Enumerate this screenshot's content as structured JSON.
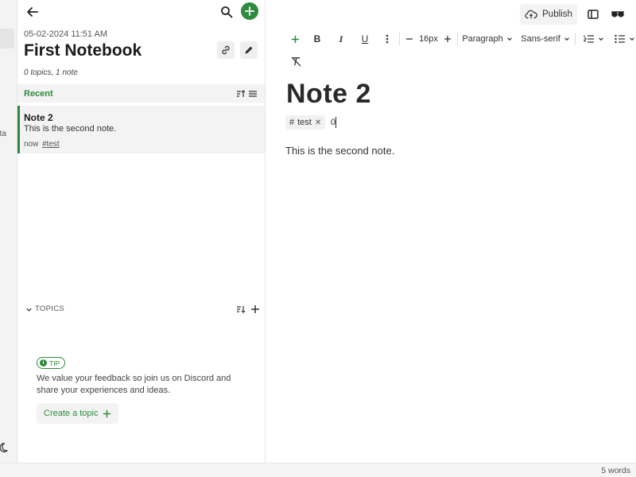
{
  "nav": {
    "beta_text": "eta"
  },
  "notebook": {
    "date": "05-02-2024 11:51 AM",
    "title": "First Notebook",
    "meta": "0 topics, 1 note"
  },
  "recent": {
    "label": "Recent",
    "notes": [
      {
        "title": "Note 2",
        "preview": "This is the second note.",
        "time": "now",
        "tag": "#test"
      }
    ]
  },
  "topics": {
    "label": "TOPICS",
    "tip_label": "TIP",
    "tip_text": "We value your feedback so join us on Discord and share your experiences and ideas.",
    "create_label": "Create a topic"
  },
  "header": {
    "publish_label": "Publish"
  },
  "toolbar": {
    "font_size": "16px",
    "block_type": "Paragraph",
    "font_family": "Sans-serif"
  },
  "editor": {
    "title": "Note 2",
    "tag": "test",
    "tag_input_value": "0",
    "body": "This is the second note."
  },
  "status": {
    "word_count": "5 words"
  },
  "colors": {
    "accent": "#2e8b3e"
  },
  "icons": [
    "arrow-left-icon",
    "search-icon",
    "plus-icon",
    "link-icon",
    "pencil-icon",
    "sort-icon",
    "list-icon",
    "chevron-down-icon",
    "cloud-upload-icon",
    "sidebar-toggle-icon",
    "glasses-icon",
    "bold-icon",
    "italic-icon",
    "underline-icon",
    "more-vertical-icon",
    "minus-icon",
    "ordered-list-icon",
    "bullet-list-icon",
    "clear-formatting-icon",
    "info-icon",
    "moon-icon"
  ]
}
